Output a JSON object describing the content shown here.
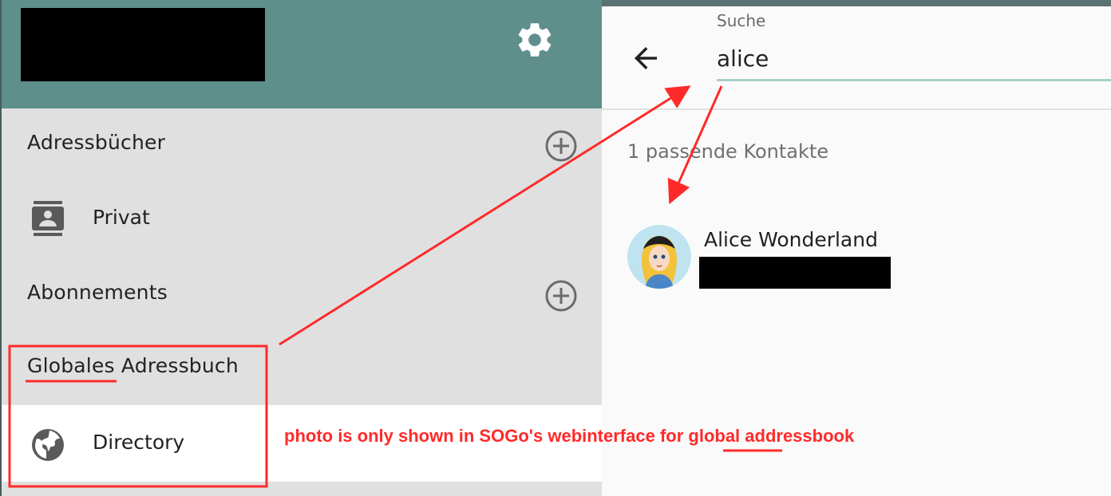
{
  "sidebar": {
    "address_books_title": "Adressbücher",
    "subscriptions_title": "Abonnements",
    "global_title": "Globales Adressbuch",
    "items": {
      "private": "Privat",
      "directory": "Directory"
    },
    "icons": {
      "settings": "gear-icon",
      "add": "add-circle-icon",
      "contacts": "contact-card-icon",
      "globe": "globe-icon"
    }
  },
  "search": {
    "label": "Suche",
    "value": "alice",
    "back_icon": "arrow-left-icon"
  },
  "results": {
    "count_text": "1 passende Kontakte",
    "contacts": [
      {
        "name": "Alice Wonderland"
      }
    ]
  },
  "annotation": {
    "note": "photo is only shown in SOGo's webinterface for global addressbook",
    "color": "#ff2a2a"
  },
  "colors": {
    "header_bg": "#5e8f8b",
    "sidebar_bg": "#e0e0e0",
    "search_underline": "#a9cfca"
  }
}
